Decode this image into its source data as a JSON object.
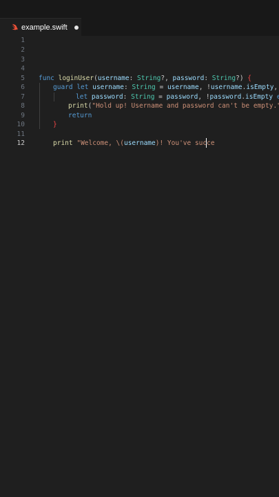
{
  "tab": {
    "filename": "example.swift",
    "icon": "swift-icon",
    "unsaved": true,
    "icon_color": "#f05138"
  },
  "colors": {
    "background": "#1f1f1f",
    "keyword": "#569cd6",
    "function": "#dcdcaa",
    "parameter": "#9cdcfe",
    "type": "#4ec9b0",
    "string": "#ce9178"
  },
  "editor": {
    "active_line": "12",
    "line_numbers": [
      "1",
      "2",
      "3",
      "4",
      "5",
      "6",
      "7",
      "8",
      "9",
      "10",
      "11",
      "12"
    ],
    "lines": {
      "l5": [
        "func ",
        "loginUser",
        "(",
        "username",
        ": ",
        "String",
        "?, ",
        "password",
        ": ",
        "String",
        "?) ",
        "{"
      ],
      "l6": [
        "guard ",
        "let ",
        "username",
        ": ",
        "String",
        " = ",
        "username",
        ", !",
        "username",
        ".",
        "isEmpty",
        ","
      ],
      "l7": [
        "let ",
        "password",
        ": ",
        "String",
        " = ",
        "password",
        ", !",
        "password",
        ".",
        "isEmpty",
        " ",
        "else"
      ],
      "l8": [
        "print",
        "(",
        "\"Hold up! Username and password can't be empty.\"",
        ")"
      ],
      "l9": [
        "return"
      ],
      "l10": [
        "}"
      ],
      "l12": [
        "print",
        " ",
        "\"Welcome, \\(",
        "username",
        ")! You've succe"
      ]
    }
  }
}
